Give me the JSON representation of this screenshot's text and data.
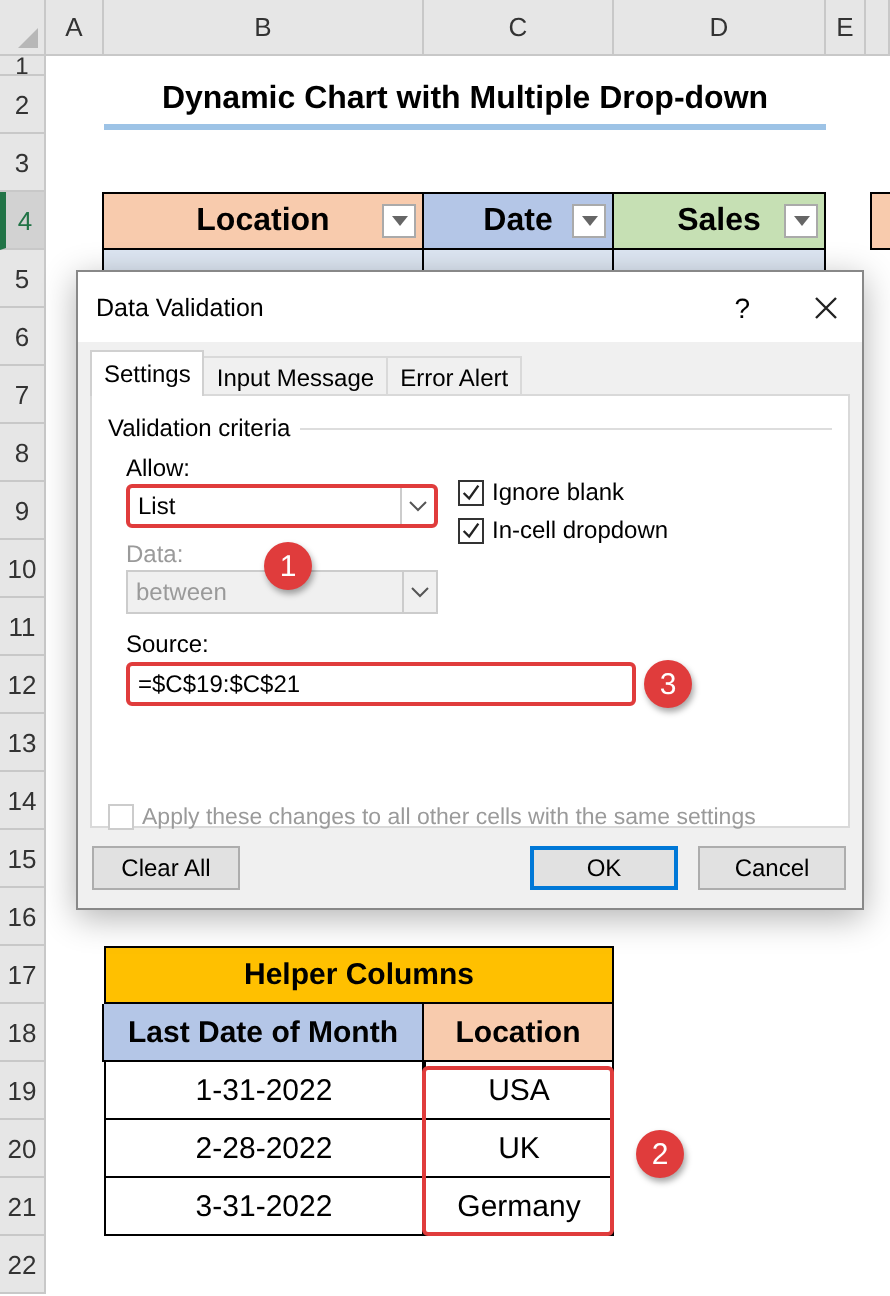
{
  "sheet": {
    "columns": [
      "A",
      "B",
      "C",
      "D",
      "E"
    ],
    "rows": [
      {
        "label": "1",
        "selected": false
      },
      {
        "label": "2",
        "selected": false
      },
      {
        "label": "3",
        "selected": false
      },
      {
        "label": "4",
        "selected": true
      },
      {
        "label": "5",
        "selected": false
      },
      {
        "label": "6",
        "selected": false
      },
      {
        "label": "7",
        "selected": false
      },
      {
        "label": "8",
        "selected": false
      },
      {
        "label": "9",
        "selected": false
      },
      {
        "label": "10",
        "selected": false
      },
      {
        "label": "11",
        "selected": false
      },
      {
        "label": "12",
        "selected": false
      },
      {
        "label": "13",
        "selected": false
      },
      {
        "label": "14",
        "selected": false
      },
      {
        "label": "15",
        "selected": false
      },
      {
        "label": "16",
        "selected": false
      },
      {
        "label": "17",
        "selected": false
      },
      {
        "label": "18",
        "selected": false
      },
      {
        "label": "19",
        "selected": false
      },
      {
        "label": "20",
        "selected": false
      },
      {
        "label": "21",
        "selected": false
      },
      {
        "label": "22",
        "selected": false
      }
    ],
    "title": "Dynamic Chart with Multiple Drop-down",
    "table_headers": [
      {
        "label": "Location",
        "color": "#f8cbad"
      },
      {
        "label": "Date",
        "color": "#b4c6e7"
      },
      {
        "label": "Sales",
        "color": "#c6e0b4"
      }
    ],
    "helper": {
      "title": "Helper Columns",
      "headers": [
        {
          "label": "Last Date of Month",
          "color": "#b4c6e7"
        },
        {
          "label": "Location",
          "color": "#f8cbad"
        }
      ],
      "rows": [
        [
          "1-31-2022",
          "USA"
        ],
        [
          "2-28-2022",
          "UK"
        ],
        [
          "3-31-2022",
          "Germany"
        ]
      ]
    }
  },
  "dialog": {
    "title": "Data Validation",
    "help": "?",
    "tabs": [
      {
        "label": "Settings",
        "selected": true
      },
      {
        "label": "Input Message",
        "selected": false
      },
      {
        "label": "Error Alert",
        "selected": false
      }
    ],
    "group": "Validation criteria",
    "allow": {
      "label": "Allow:",
      "value": "List",
      "highlighted": true
    },
    "checkboxes": [
      {
        "label": "Ignore blank",
        "checked": true
      },
      {
        "label": "In-cell dropdown",
        "checked": true
      }
    ],
    "data": {
      "label": "Data:",
      "value": "between",
      "disabled": true
    },
    "source": {
      "label": "Source:",
      "value": "=$C$19:$C$21",
      "highlighted": true
    },
    "apply": {
      "label": "Apply these changes to all other cells with the same settings",
      "checked": false,
      "disabled": true
    },
    "buttons": [
      {
        "label": "Clear All",
        "default": false
      },
      {
        "label": "OK",
        "default": true
      },
      {
        "label": "Cancel",
        "default": false
      }
    ]
  },
  "callouts": [
    "1",
    "2",
    "3"
  ]
}
